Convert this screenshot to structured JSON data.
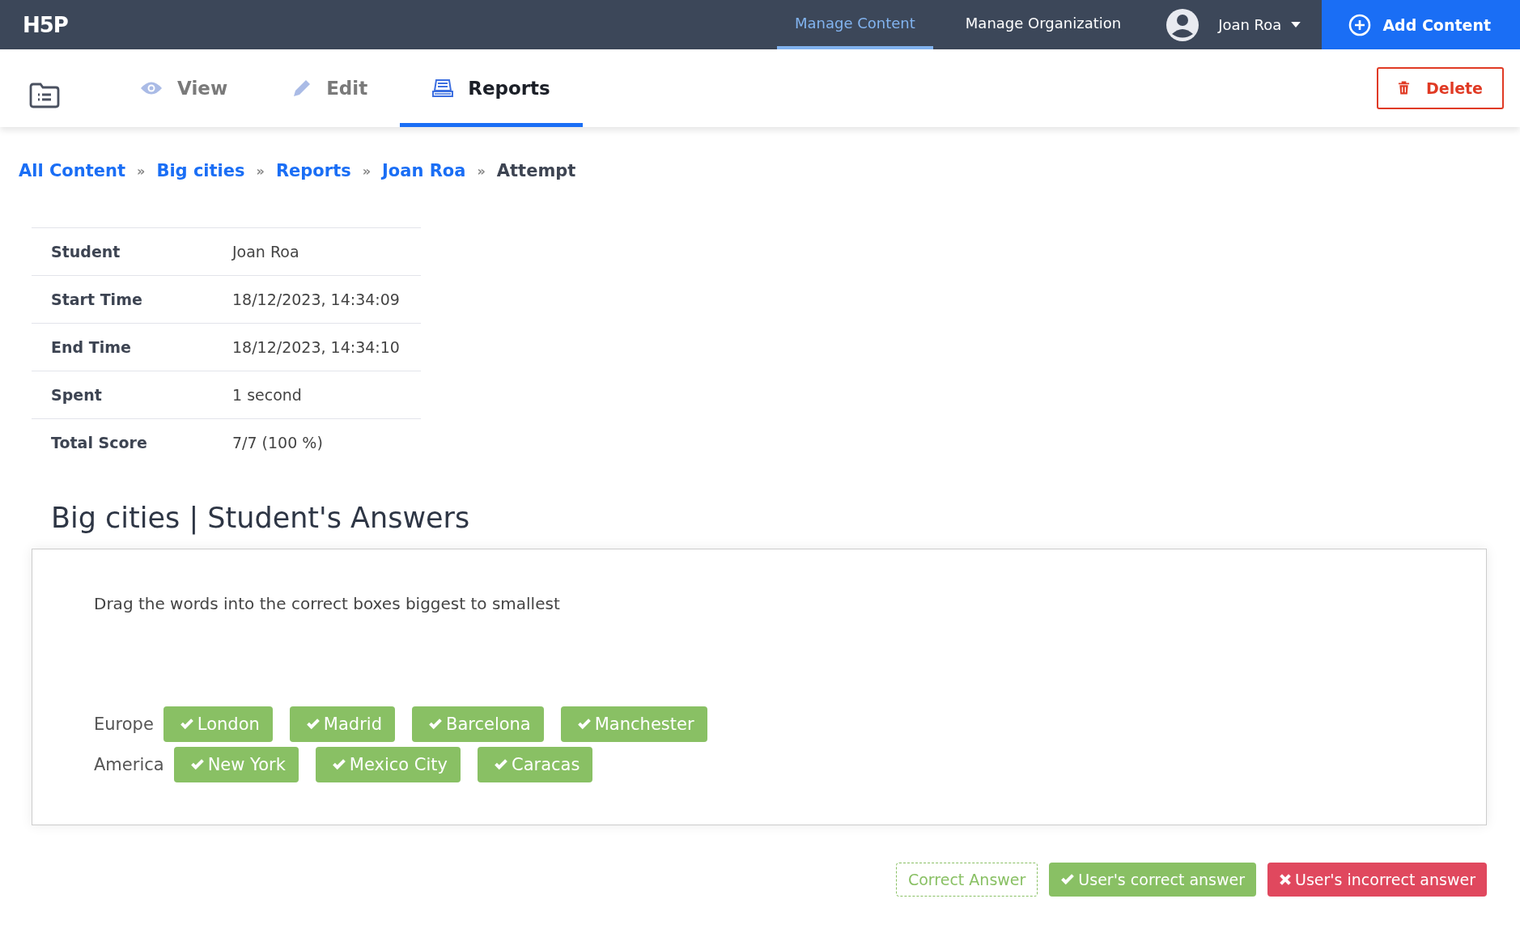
{
  "logo": "H5P",
  "top_nav": [
    {
      "label": "Manage Content",
      "selected": true
    },
    {
      "label": "Manage Organization",
      "selected": false
    }
  ],
  "user": {
    "name": "Joan Roa"
  },
  "add_button": "Add Content",
  "tabs": [
    {
      "label": "View",
      "kind": "view",
      "selected": false
    },
    {
      "label": "Edit",
      "kind": "edit",
      "selected": false
    },
    {
      "label": "Reports",
      "kind": "reports",
      "selected": true
    }
  ],
  "delete_button": "Delete",
  "breadcrumbs": [
    {
      "label": "All Content",
      "link": true
    },
    {
      "label": "Big cities",
      "link": true
    },
    {
      "label": "Reports",
      "link": true
    },
    {
      "label": "Joan Roa",
      "link": true
    },
    {
      "label": "Attempt",
      "link": false
    }
  ],
  "breadcrumb_separator": "»",
  "details": [
    {
      "label": "Student",
      "value": "Joan Roa"
    },
    {
      "label": "Start Time",
      "value": "18/12/2023, 14:34:09"
    },
    {
      "label": "End Time",
      "value": "18/12/2023, 14:34:10"
    },
    {
      "label": "Spent",
      "value": "1 second"
    },
    {
      "label": "Total Score",
      "value": "7/7 (100 %)"
    }
  ],
  "answers_title": "Big cities | Student's Answers",
  "question": {
    "instruction": "Drag the words into the correct boxes biggest to smallest",
    "rows": [
      {
        "label": "Europe",
        "answers": [
          {
            "text": "London",
            "correct": true
          },
          {
            "text": "Madrid",
            "correct": true
          },
          {
            "text": "Barcelona",
            "correct": true
          },
          {
            "text": "Manchester",
            "correct": true
          }
        ]
      },
      {
        "label": "America",
        "answers": [
          {
            "text": "New York",
            "correct": true
          },
          {
            "text": "Mexico City",
            "correct": true
          },
          {
            "text": "Caracas",
            "correct": true
          }
        ]
      }
    ]
  },
  "legend": [
    {
      "kind": "correct-answer",
      "label": "Correct Answer"
    },
    {
      "kind": "user-correct",
      "label": "User's correct answer"
    },
    {
      "kind": "user-incorrect",
      "label": "User's incorrect answer"
    }
  ]
}
